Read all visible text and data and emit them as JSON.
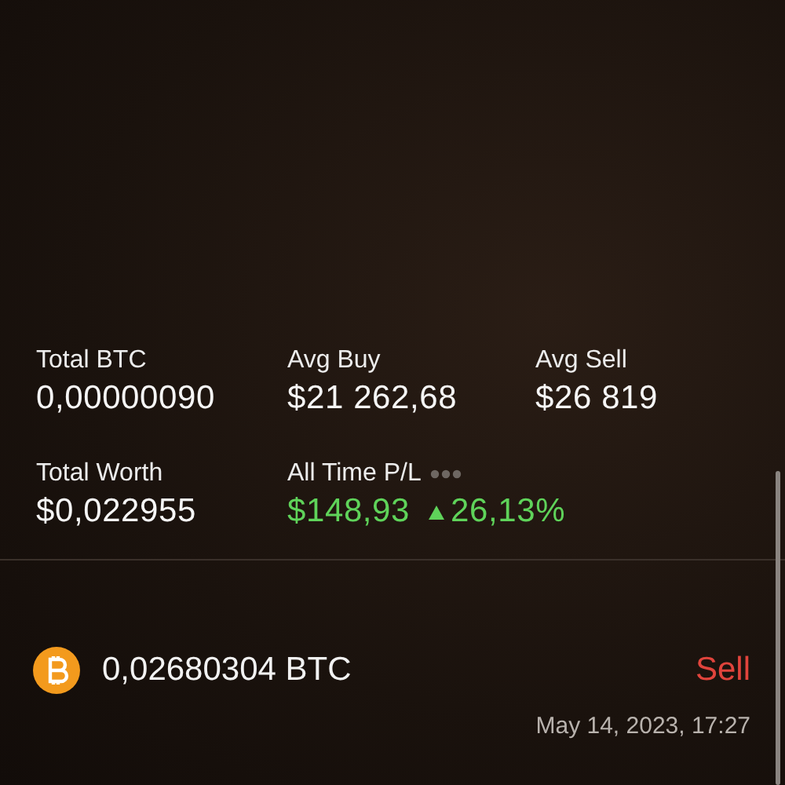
{
  "stats": [
    {
      "label": "Total BTC",
      "value": "0,00000090"
    },
    {
      "label": "Avg Buy",
      "value": "$21 262,68"
    },
    {
      "label": "Avg Sell",
      "value": "$26 819"
    }
  ],
  "summary": {
    "worth_label": "Total Worth",
    "worth_value": "$0,022955",
    "pl_label": "All Time P/L",
    "pl_value": "$148,93",
    "pl_percent": "26,13%",
    "up": true
  },
  "transactions": [
    {
      "amount": "0,02680304 BTC",
      "kind": "sell",
      "type_label": "Sell",
      "date": "May 14, 2023, 17:27"
    }
  ]
}
